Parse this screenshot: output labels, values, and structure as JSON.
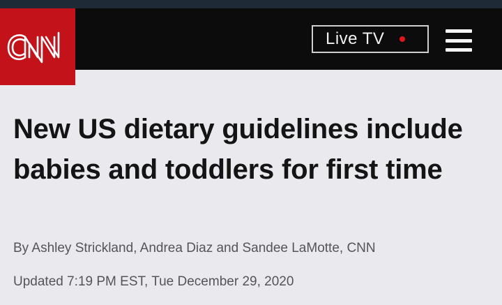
{
  "header": {
    "logo_text": "CNN",
    "live_tv_label": "Live TV",
    "menu_icon": "hamburger-menu-icon",
    "brand_color": "#c4121b",
    "live_dot_color": "#e0161e"
  },
  "article": {
    "headline": "New US dietary guidelines include babies and toddlers for first time",
    "byline": "By Ashley Strickland, Andrea Diaz and Sandee LaMotte, CNN",
    "updated": "Updated 7:19 PM EST, Tue December 29, 2020"
  }
}
